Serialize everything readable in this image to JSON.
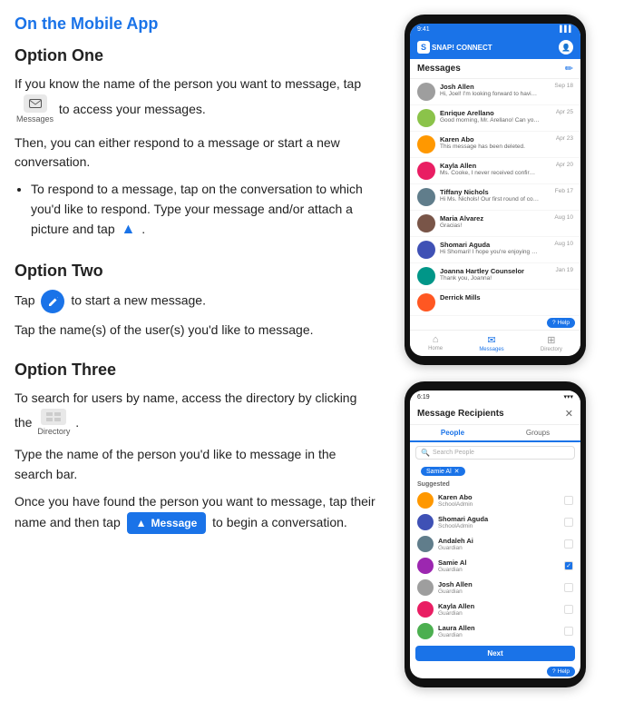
{
  "header": {
    "title": "On the Mobile App"
  },
  "sections": [
    {
      "id": "option-one",
      "title": "Option One",
      "paragraphs": [
        "If you know the name of the person you want to message, tap",
        "to access your messages.",
        "Then, you can either respond to a message or start a new conversation.",
        "To respond to a message, tap on the conversation to which you'd like to respond. Type your message and/or attach a picture and tap",
        "."
      ],
      "messages_icon_label": "Messages",
      "bullet_text": "To respond to a message, tap on the conversation to which you'd like to respond. Type your message and/or attach a picture and tap"
    },
    {
      "id": "option-two",
      "title": "Option Two",
      "paragraphs": [
        "Tap",
        "to start a new message.",
        "Tap the name(s) of the user(s) you'd like to message."
      ]
    },
    {
      "id": "option-three",
      "title": "Option Three",
      "paragraphs": [
        "To search for users by name, access the directory by clicking the",
        ".",
        "Type the name of the person you'd like to message in the search bar.",
        "Once you have found the person you want to message, tap their name and then tap",
        "to begin a conversation."
      ],
      "directory_label": "Directory",
      "message_btn_label": "Message"
    }
  ],
  "phone1": {
    "statusbar": {
      "time": "9:41",
      "battery": "●●●"
    },
    "logo": "SNAP! CONNECT",
    "messages_header": "Messages",
    "messages": [
      {
        "name": "Josh Allen",
        "date": "Sep 18",
        "preview": "Hi, Joel! I'm looking forward to having Cate ..."
      },
      {
        "name": "Enrique Arellano",
        "date": "Apr 25",
        "preview": "Good morning, Mr. Arellano! Can you chan..."
      },
      {
        "name": "Karen Abo",
        "date": "Apr 23",
        "preview": "This message has been deleted."
      },
      {
        "name": "Kayla Allen",
        "date": "Apr 20",
        "preview": "Ms. Cooke, I never received confirmation of..."
      },
      {
        "name": "Tiffany Nichols",
        "date": "Feb 17",
        "preview": "Hi Ms. Nichols! Our first round of conferen..."
      },
      {
        "name": "Maria Alvarez",
        "date": "Aug 10",
        "preview": "Gracias!"
      },
      {
        "name": "Shomari Aguda",
        "date": "Aug 10",
        "preview": "Hi Shomari! I hope you're enjoying your new..."
      },
      {
        "name": "Joanna Hartley Counselor",
        "date": "Jan 19",
        "preview": "Thank you, Joanna!"
      },
      {
        "name": "Derrick Mills",
        "date": "",
        "preview": ""
      }
    ],
    "nav": [
      {
        "label": "Home",
        "icon": "⌂",
        "active": false
      },
      {
        "label": "Messages",
        "icon": "✉",
        "active": true
      },
      {
        "label": "Directory",
        "icon": "⊞",
        "active": false
      }
    ],
    "help_label": "Help"
  },
  "phone2": {
    "statusbar": {
      "time": "6:19"
    },
    "title": "Message Recipients",
    "tabs": [
      "People",
      "Groups"
    ],
    "search_placeholder": "Search People",
    "tag": "Samie Al",
    "suggested_label": "Suggested",
    "people": [
      {
        "name": "Karen Abo",
        "role": "SchoolAdmin",
        "checked": false
      },
      {
        "name": "Shomari Aguda",
        "role": "SchoolAdmin",
        "checked": false
      },
      {
        "name": "Andaleh Ai",
        "role": "Guardian",
        "checked": false
      },
      {
        "name": "Samie Al",
        "role": "Guardian",
        "checked": true
      },
      {
        "name": "Josh Allen",
        "role": "Guardian",
        "checked": false
      },
      {
        "name": "Kayla Allen",
        "role": "Guardian",
        "checked": false
      },
      {
        "name": "Laura Allen",
        "role": "Guardian",
        "checked": false
      }
    ],
    "next_btn": "Next",
    "help_label": "Help"
  }
}
